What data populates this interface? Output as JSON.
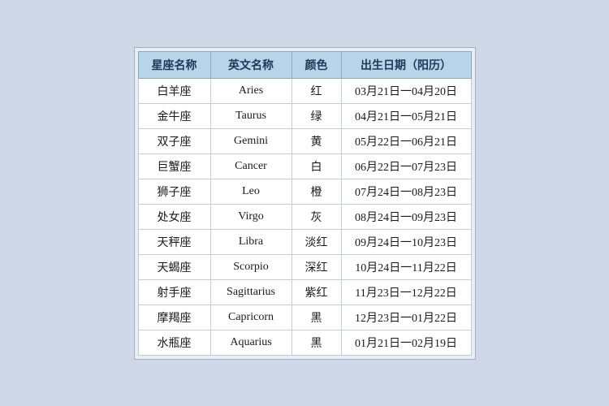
{
  "table": {
    "headers": [
      "星座名称",
      "英文名称",
      "颜色",
      "出生日期（阳历）"
    ],
    "rows": [
      {
        "zh": "白羊座",
        "en": "Aries",
        "color": "红",
        "date": "03月21日一04月20日"
      },
      {
        "zh": "金牛座",
        "en": "Taurus",
        "color": "绿",
        "date": "04月21日一05月21日"
      },
      {
        "zh": "双子座",
        "en": "Gemini",
        "color": "黄",
        "date": "05月22日一06月21日"
      },
      {
        "zh": "巨蟹座",
        "en": "Cancer",
        "color": "白",
        "date": "06月22日一07月23日"
      },
      {
        "zh": "狮子座",
        "en": "Leo",
        "color": "橙",
        "date": "07月24日一08月23日"
      },
      {
        "zh": "处女座",
        "en": "Virgo",
        "color": "灰",
        "date": "08月24日一09月23日"
      },
      {
        "zh": "天秤座",
        "en": "Libra",
        "color": "淡红",
        "date": "09月24日一10月23日"
      },
      {
        "zh": "天蝎座",
        "en": "Scorpio",
        "color": "深红",
        "date": "10月24日一11月22日"
      },
      {
        "zh": "射手座",
        "en": "Sagittarius",
        "color": "紫红",
        "date": "11月23日一12月22日"
      },
      {
        "zh": "摩羯座",
        "en": "Capricorn",
        "color": "黑",
        "date": "12月23日一01月22日"
      },
      {
        "zh": "水瓶座",
        "en": "Aquarius",
        "color": "黑",
        "date": "01月21日一02月19日"
      }
    ]
  }
}
